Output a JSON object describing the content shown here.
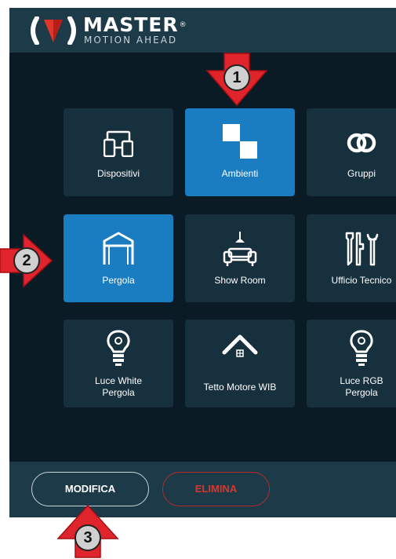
{
  "header": {
    "brand": "MASTER",
    "registered": "®",
    "tagline": "MOTION AHEAD"
  },
  "tiles": [
    {
      "label": "Dispositivi",
      "icon": "devices-icon",
      "active": false
    },
    {
      "label": "Ambienti",
      "icon": "rooms-icon",
      "active": true
    },
    {
      "label": "Gruppi",
      "icon": "groups-icon",
      "active": false
    },
    {
      "label": "Pergola",
      "icon": "pergola-icon",
      "active": true
    },
    {
      "label": "Show Room",
      "icon": "sofa-lamp-icon",
      "active": false
    },
    {
      "label": "Ufficio Tecnico",
      "icon": "tools-icon",
      "active": false
    },
    {
      "label": "Luce White\nPergola",
      "icon": "bulb-icon",
      "active": false
    },
    {
      "label": "Tetto Motore WIB",
      "icon": "roof-icon",
      "active": false
    },
    {
      "label": "Luce RGB\nPergola",
      "icon": "bulb-icon",
      "active": false
    }
  ],
  "footer": {
    "edit_label": "MODIFICA",
    "delete_label": "ELIMINA"
  },
  "markers": [
    {
      "number": "1",
      "direction": "down"
    },
    {
      "number": "2",
      "direction": "right"
    },
    {
      "number": "3",
      "direction": "up"
    }
  ],
  "colors": {
    "background": "#0b1b25",
    "header": "#1d3a49",
    "tile": "#17303d",
    "tile_active": "#1a7cc1",
    "delete": "#d13a32",
    "marker_arrow": "#e0242b"
  }
}
